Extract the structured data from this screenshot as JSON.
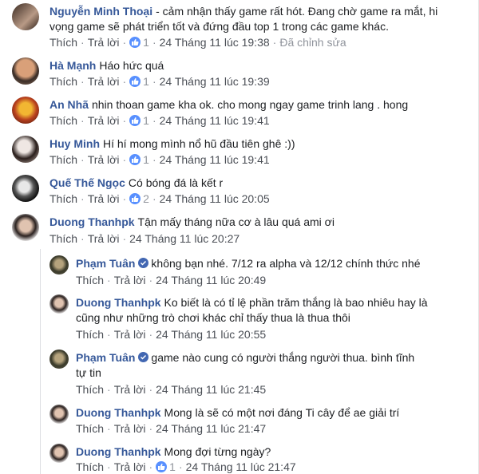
{
  "comments": [
    {
      "author": "Nguyễn Minh Thoại",
      "text_line1": "- cảm nhận thấy game rất hót. Đang chờ game ra mắt, hi",
      "text_line2": "vọng game sẽ phát triển tốt và đứng đầu top 1 trong các game khác.",
      "like": "Thích",
      "reply": "Trả lời",
      "likes": "1",
      "time": "24 Tháng 11 lúc 19:38",
      "edited": "Đã chỉnh sửa"
    },
    {
      "author": "Hà Mạnh",
      "text": "Háo hức quá",
      "like": "Thích",
      "reply": "Trả lời",
      "likes": "1",
      "time": "24 Tháng 11 lúc 19:39"
    },
    {
      "author": "An Nhã",
      "text": "nhin thoan game kha ok. cho mong ngay game trinh lang . hong",
      "like": "Thích",
      "reply": "Trả lời",
      "likes": "1",
      "time": "24 Tháng 11 lúc 19:41"
    },
    {
      "author": "Huy Minh",
      "text": "Hí hí mong mình nổ hũ đầu tiên ghê :))",
      "like": "Thích",
      "reply": "Trả lời",
      "likes": "1",
      "time": "24 Tháng 11 lúc 19:41"
    },
    {
      "author": "Quế Thế Ngọc",
      "text": "Có bóng đá là kết r",
      "like": "Thích",
      "reply": "Trả lời",
      "likes": "2",
      "time": "24 Tháng 11 lúc 20:05"
    },
    {
      "author": "Duong Thanhpk",
      "text": "Tận mấy tháng nữa cơ à lâu quá ami ơi",
      "like": "Thích",
      "reply": "Trả lời",
      "time": "24 Tháng 11 lúc 20:27"
    }
  ],
  "replies": [
    {
      "author": "Phạm Tuân",
      "text": "không bạn nhé. 7/12 ra alpha và 12/12 chính thức nhé",
      "like": "Thích",
      "reply": "Trả lời",
      "time": "24 Tháng 11 lúc 20:49"
    },
    {
      "author": "Duong Thanhpk",
      "text_line1": "Ko biết là có tỉ lệ phần trăm thắng là bao nhiêu hay là",
      "text_line2": "cũng như những trò chơi khác chỉ thấy thua là thua thôi",
      "like": "Thích",
      "reply": "Trả lời",
      "time": "24 Tháng 11 lúc 20:55"
    },
    {
      "author": "Phạm Tuân",
      "text_line1": "game nào cung có người thắng người thua. bình tĩnh",
      "text_line2": "tự tin",
      "like": "Thích",
      "reply": "Trả lời",
      "time": "24 Tháng 11 lúc 21:45"
    },
    {
      "author": "Duong Thanhpk",
      "text": "Mong là sẽ có một nơi đáng Ti cây để ae giải trí",
      "like": "Thích",
      "reply": "Trả lời",
      "time": "24 Tháng 11 lúc 21:47"
    },
    {
      "author": "Duong Thanhpk",
      "text": "Mong đợi từng ngày?",
      "like": "Thích",
      "reply": "Trả lời",
      "likes": "1",
      "time": "24 Tháng 11 lúc 21:47"
    }
  ],
  "colors": {
    "author": "#365899",
    "like_badge": "#5890ff",
    "meta": "#90949c"
  }
}
